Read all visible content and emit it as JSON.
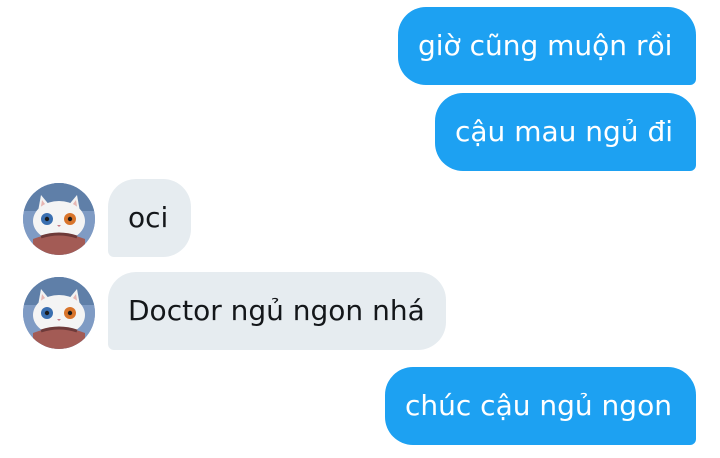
{
  "messages": [
    {
      "direction": "outgoing",
      "text": "giờ cũng muộn rồi"
    },
    {
      "direction": "outgoing",
      "text": "cậu mau ngủ đi"
    },
    {
      "direction": "incoming",
      "text": "oci",
      "avatar": "cat-avatar-icon"
    },
    {
      "direction": "incoming",
      "text": "Doctor ngủ ngon nhá",
      "avatar": "cat-avatar-icon"
    },
    {
      "direction": "outgoing",
      "text": "chúc cậu ngủ ngon"
    }
  ],
  "colors": {
    "outgoing_bubble": "#1da1f2",
    "incoming_bubble": "#e6ecf0",
    "outgoing_text": "#ffffff",
    "incoming_text": "#14171a"
  }
}
